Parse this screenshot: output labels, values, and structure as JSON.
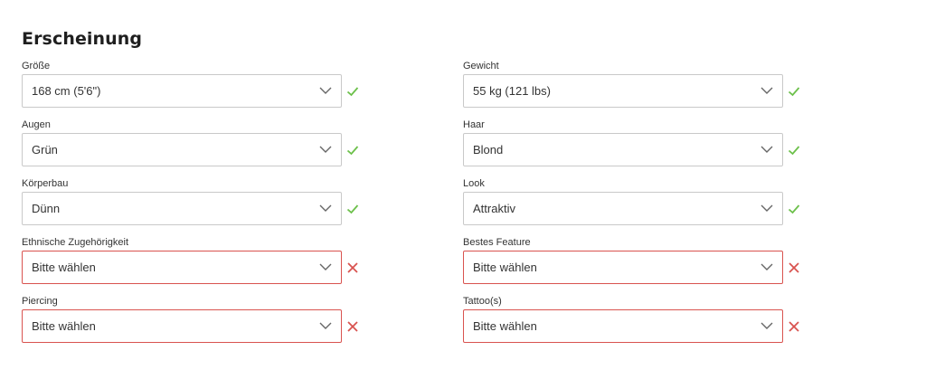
{
  "section": {
    "title": "Erscheinung"
  },
  "colors": {
    "valid": "#6cc04a",
    "invalid": "#d9534f"
  },
  "fields": {
    "groesse": {
      "label": "Größe",
      "value": "168 cm (5'6\")",
      "status": "valid",
      "icon": "check-icon"
    },
    "gewicht": {
      "label": "Gewicht",
      "value": "55 kg (121 lbs)",
      "status": "valid",
      "icon": "check-icon"
    },
    "augen": {
      "label": "Augen",
      "value": "Grün",
      "status": "valid",
      "icon": "check-icon"
    },
    "haar": {
      "label": "Haar",
      "value": "Blond",
      "status": "valid",
      "icon": "check-icon"
    },
    "koerperbau": {
      "label": "Körperbau",
      "value": "Dünn",
      "status": "valid",
      "icon": "check-icon"
    },
    "look": {
      "label": "Look",
      "value": "Attraktiv",
      "status": "valid",
      "icon": "check-icon"
    },
    "ethnie": {
      "label": "Ethnische Zugehörigkeit",
      "value": "Bitte wählen",
      "status": "invalid",
      "icon": "x-icon"
    },
    "feature": {
      "label": "Bestes Feature",
      "value": "Bitte wählen",
      "status": "invalid",
      "icon": "x-icon"
    },
    "piercing": {
      "label": "Piercing",
      "value": "Bitte wählen",
      "status": "invalid",
      "icon": "x-icon"
    },
    "tattoo": {
      "label": "Tattoo(s)",
      "value": "Bitte wählen",
      "status": "invalid",
      "icon": "x-icon"
    }
  }
}
